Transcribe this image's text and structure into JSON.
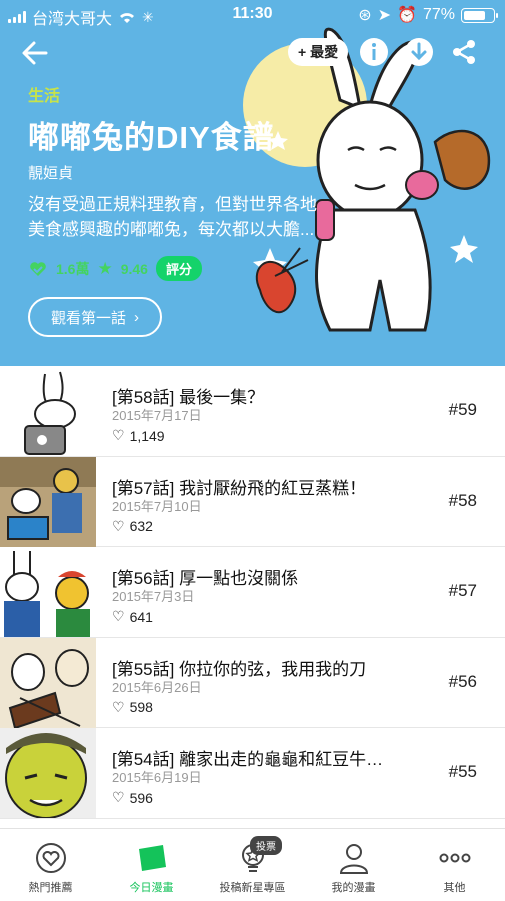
{
  "status_bar": {
    "carrier": "台湾大哥大",
    "time": "11:30",
    "battery": "77%",
    "battery_level": 0.77
  },
  "header": {
    "favorite_label": "+ 最愛",
    "genre": "生活",
    "title": "嘟嘟兔的DIY食譜",
    "author": "靚姮貞",
    "description": "沒有受過正規料理教育，但對世界各地美食感興趣的嘟嘟兔，每次都以大膽...",
    "likes": "1.6萬",
    "rating": "9.46",
    "rate_label": "評分",
    "first_episode_label": "觀看第一話",
    "colors": {
      "hero": "#5fb4e4",
      "accent": "#14d36a",
      "genre": "#c7e34a"
    }
  },
  "episodes": [
    {
      "title": "[第58話] 最後一集？",
      "date": "2015年7月17日",
      "likes": "1,149",
      "number": "#59"
    },
    {
      "title": "[第57話] 我討厭紛飛的紅豆蒸糕！",
      "date": "2015年7月10日",
      "likes": "632",
      "number": "#58"
    },
    {
      "title": "[第56話] 厚一點也沒關係",
      "date": "2015年7月3日",
      "likes": "641",
      "number": "#57"
    },
    {
      "title": "[第55話] 你拉你的弦，我用我的刀",
      "date": "2015年6月26日",
      "likes": "598",
      "number": "#56"
    },
    {
      "title": "[第54話] 離家出走的龜龜和紅豆牛…",
      "date": "2015年6月19日",
      "likes": "596",
      "number": "#55"
    }
  ],
  "tabs": [
    {
      "label": "熱門推薦",
      "icon": "heart-circle-icon"
    },
    {
      "label": "今日漫畫",
      "icon": "today-comic-icon"
    },
    {
      "label": "投稿新星專區",
      "icon": "star-bulb-icon",
      "badge": "投票"
    },
    {
      "label": "我的漫畫",
      "icon": "person-icon"
    },
    {
      "label": "其他",
      "icon": "more-icon"
    }
  ]
}
